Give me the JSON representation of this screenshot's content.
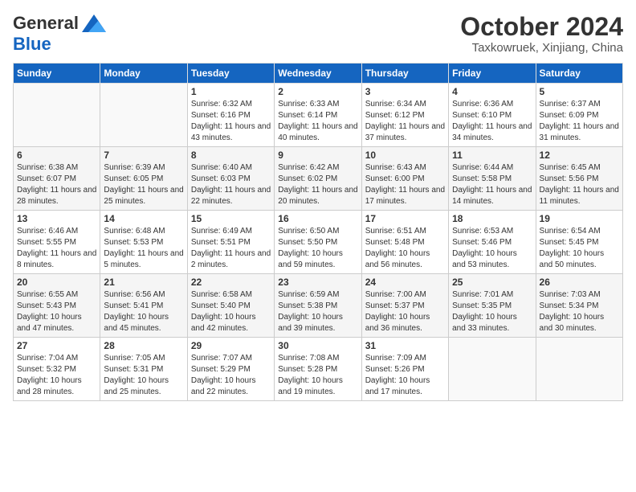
{
  "logo": {
    "general": "General",
    "blue": "Blue"
  },
  "title": {
    "month": "October 2024",
    "location": "Taxkowruek, Xinjiang, China"
  },
  "days_of_week": [
    "Sunday",
    "Monday",
    "Tuesday",
    "Wednesday",
    "Thursday",
    "Friday",
    "Saturday"
  ],
  "weeks": [
    [
      {
        "day": "",
        "empty": true
      },
      {
        "day": "",
        "empty": true
      },
      {
        "day": "1",
        "sunrise": "Sunrise: 6:32 AM",
        "sunset": "Sunset: 6:16 PM",
        "daylight": "Daylight: 11 hours and 43 minutes."
      },
      {
        "day": "2",
        "sunrise": "Sunrise: 6:33 AM",
        "sunset": "Sunset: 6:14 PM",
        "daylight": "Daylight: 11 hours and 40 minutes."
      },
      {
        "day": "3",
        "sunrise": "Sunrise: 6:34 AM",
        "sunset": "Sunset: 6:12 PM",
        "daylight": "Daylight: 11 hours and 37 minutes."
      },
      {
        "day": "4",
        "sunrise": "Sunrise: 6:36 AM",
        "sunset": "Sunset: 6:10 PM",
        "daylight": "Daylight: 11 hours and 34 minutes."
      },
      {
        "day": "5",
        "sunrise": "Sunrise: 6:37 AM",
        "sunset": "Sunset: 6:09 PM",
        "daylight": "Daylight: 11 hours and 31 minutes."
      }
    ],
    [
      {
        "day": "6",
        "sunrise": "Sunrise: 6:38 AM",
        "sunset": "Sunset: 6:07 PM",
        "daylight": "Daylight: 11 hours and 28 minutes."
      },
      {
        "day": "7",
        "sunrise": "Sunrise: 6:39 AM",
        "sunset": "Sunset: 6:05 PM",
        "daylight": "Daylight: 11 hours and 25 minutes."
      },
      {
        "day": "8",
        "sunrise": "Sunrise: 6:40 AM",
        "sunset": "Sunset: 6:03 PM",
        "daylight": "Daylight: 11 hours and 22 minutes."
      },
      {
        "day": "9",
        "sunrise": "Sunrise: 6:42 AM",
        "sunset": "Sunset: 6:02 PM",
        "daylight": "Daylight: 11 hours and 20 minutes."
      },
      {
        "day": "10",
        "sunrise": "Sunrise: 6:43 AM",
        "sunset": "Sunset: 6:00 PM",
        "daylight": "Daylight: 11 hours and 17 minutes."
      },
      {
        "day": "11",
        "sunrise": "Sunrise: 6:44 AM",
        "sunset": "Sunset: 5:58 PM",
        "daylight": "Daylight: 11 hours and 14 minutes."
      },
      {
        "day": "12",
        "sunrise": "Sunrise: 6:45 AM",
        "sunset": "Sunset: 5:56 PM",
        "daylight": "Daylight: 11 hours and 11 minutes."
      }
    ],
    [
      {
        "day": "13",
        "sunrise": "Sunrise: 6:46 AM",
        "sunset": "Sunset: 5:55 PM",
        "daylight": "Daylight: 11 hours and 8 minutes."
      },
      {
        "day": "14",
        "sunrise": "Sunrise: 6:48 AM",
        "sunset": "Sunset: 5:53 PM",
        "daylight": "Daylight: 11 hours and 5 minutes."
      },
      {
        "day": "15",
        "sunrise": "Sunrise: 6:49 AM",
        "sunset": "Sunset: 5:51 PM",
        "daylight": "Daylight: 11 hours and 2 minutes."
      },
      {
        "day": "16",
        "sunrise": "Sunrise: 6:50 AM",
        "sunset": "Sunset: 5:50 PM",
        "daylight": "Daylight: 10 hours and 59 minutes."
      },
      {
        "day": "17",
        "sunrise": "Sunrise: 6:51 AM",
        "sunset": "Sunset: 5:48 PM",
        "daylight": "Daylight: 10 hours and 56 minutes."
      },
      {
        "day": "18",
        "sunrise": "Sunrise: 6:53 AM",
        "sunset": "Sunset: 5:46 PM",
        "daylight": "Daylight: 10 hours and 53 minutes."
      },
      {
        "day": "19",
        "sunrise": "Sunrise: 6:54 AM",
        "sunset": "Sunset: 5:45 PM",
        "daylight": "Daylight: 10 hours and 50 minutes."
      }
    ],
    [
      {
        "day": "20",
        "sunrise": "Sunrise: 6:55 AM",
        "sunset": "Sunset: 5:43 PM",
        "daylight": "Daylight: 10 hours and 47 minutes."
      },
      {
        "day": "21",
        "sunrise": "Sunrise: 6:56 AM",
        "sunset": "Sunset: 5:41 PM",
        "daylight": "Daylight: 10 hours and 45 minutes."
      },
      {
        "day": "22",
        "sunrise": "Sunrise: 6:58 AM",
        "sunset": "Sunset: 5:40 PM",
        "daylight": "Daylight: 10 hours and 42 minutes."
      },
      {
        "day": "23",
        "sunrise": "Sunrise: 6:59 AM",
        "sunset": "Sunset: 5:38 PM",
        "daylight": "Daylight: 10 hours and 39 minutes."
      },
      {
        "day": "24",
        "sunrise": "Sunrise: 7:00 AM",
        "sunset": "Sunset: 5:37 PM",
        "daylight": "Daylight: 10 hours and 36 minutes."
      },
      {
        "day": "25",
        "sunrise": "Sunrise: 7:01 AM",
        "sunset": "Sunset: 5:35 PM",
        "daylight": "Daylight: 10 hours and 33 minutes."
      },
      {
        "day": "26",
        "sunrise": "Sunrise: 7:03 AM",
        "sunset": "Sunset: 5:34 PM",
        "daylight": "Daylight: 10 hours and 30 minutes."
      }
    ],
    [
      {
        "day": "27",
        "sunrise": "Sunrise: 7:04 AM",
        "sunset": "Sunset: 5:32 PM",
        "daylight": "Daylight: 10 hours and 28 minutes."
      },
      {
        "day": "28",
        "sunrise": "Sunrise: 7:05 AM",
        "sunset": "Sunset: 5:31 PM",
        "daylight": "Daylight: 10 hours and 25 minutes."
      },
      {
        "day": "29",
        "sunrise": "Sunrise: 7:07 AM",
        "sunset": "Sunset: 5:29 PM",
        "daylight": "Daylight: 10 hours and 22 minutes."
      },
      {
        "day": "30",
        "sunrise": "Sunrise: 7:08 AM",
        "sunset": "Sunset: 5:28 PM",
        "daylight": "Daylight: 10 hours and 19 minutes."
      },
      {
        "day": "31",
        "sunrise": "Sunrise: 7:09 AM",
        "sunset": "Sunset: 5:26 PM",
        "daylight": "Daylight: 10 hours and 17 minutes."
      },
      {
        "day": "",
        "empty": true
      },
      {
        "day": "",
        "empty": true
      }
    ]
  ]
}
